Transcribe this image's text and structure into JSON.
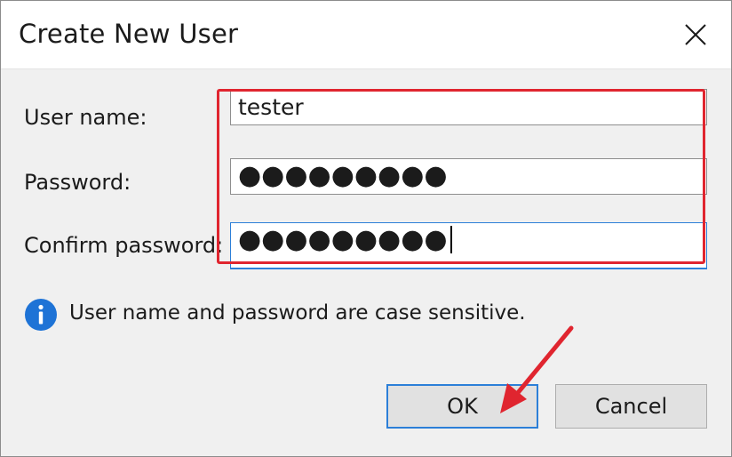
{
  "dialog": {
    "title": "Create New User",
    "close_icon": "close-icon"
  },
  "form": {
    "username_label": "User name:",
    "username_value": "tester",
    "password_label": "Password:",
    "password_value": "●●●●●●●●●",
    "confirm_label": "Confirm password:",
    "confirm_value": "●●●●●●●●●"
  },
  "info": {
    "icon": "info-icon",
    "text": "User name and password are case sensitive."
  },
  "buttons": {
    "ok_label": "OK",
    "cancel_label": "Cancel"
  },
  "annotation": {
    "highlight_color": "#e0252f",
    "arrow_color": "#e0252f"
  },
  "colors": {
    "accent": "#2c7fd8",
    "info_icon": "#1e73d6"
  }
}
